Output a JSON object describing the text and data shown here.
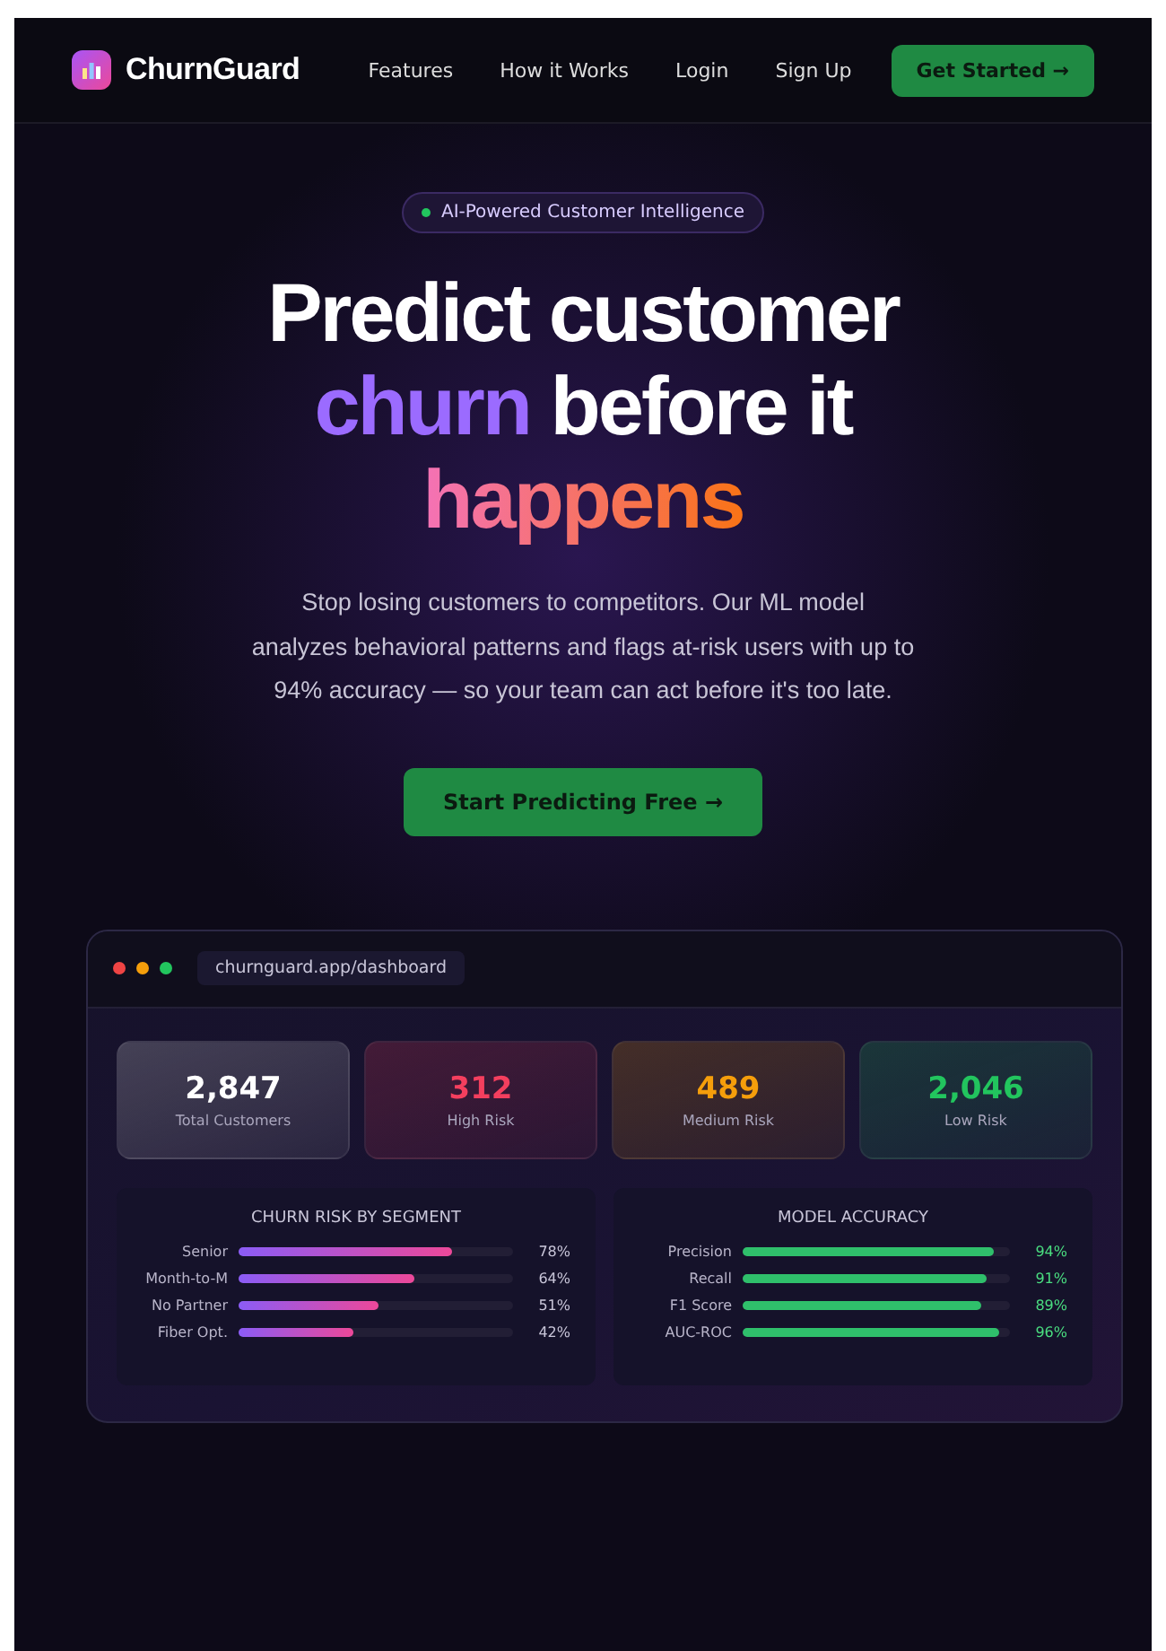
{
  "nav": {
    "brand": "ChurnGuard",
    "links": [
      "Features",
      "How it Works",
      "Login",
      "Sign Up"
    ],
    "cta": "Get Started →"
  },
  "hero": {
    "badge": "AI-Powered Customer Intelligence",
    "headline": [
      [
        {
          "text": "Predict customer",
          "kind": "plain"
        }
      ],
      [
        {
          "text": "churn",
          "kind": "violet"
        },
        {
          "text": " before it",
          "kind": "plain"
        }
      ],
      [
        {
          "text": "happens",
          "kind": "gradient"
        }
      ]
    ],
    "subtitle": "Stop losing customers to competitors. Our ML model analyzes behavioral patterns and flags at-risk users with up to 94% accuracy — so your team can act before it's too late.",
    "button": "Start Predicting Free →"
  },
  "dashboard": {
    "url": "churnguard.app/dashboard",
    "stats": [
      {
        "value": "2,847",
        "label": "Total Customers",
        "color": "#ffffff"
      },
      {
        "value": "312",
        "label": "High Risk",
        "color": "#f43f5e"
      },
      {
        "value": "489",
        "label": "Medium Risk",
        "color": "#f59e0b"
      },
      {
        "value": "2,046",
        "label": "Low Risk",
        "color": "#22c55e"
      }
    ],
    "panels": [
      {
        "title": "CHURN RISK BY SEGMENT",
        "kind": "risk",
        "rows": [
          {
            "label": "Senior",
            "level": 0.78,
            "reading": "78%"
          },
          {
            "label": "Month-to-M",
            "level": 0.64,
            "reading": "64%"
          },
          {
            "label": "No Partner",
            "level": 0.51,
            "reading": "51%"
          },
          {
            "label": "Fiber Opt.",
            "level": 0.42,
            "reading": "42%"
          }
        ]
      },
      {
        "title": "MODEL ACCURACY",
        "kind": "accuracy",
        "rows": [
          {
            "label": "Precision",
            "level": 0.94,
            "reading": "94%"
          },
          {
            "label": "Recall",
            "level": 0.91,
            "reading": "91%"
          },
          {
            "label": "F1 Score",
            "level": 0.89,
            "reading": "89%"
          },
          {
            "label": "AUC-ROC",
            "level": 0.96,
            "reading": "96%"
          }
        ]
      }
    ]
  }
}
